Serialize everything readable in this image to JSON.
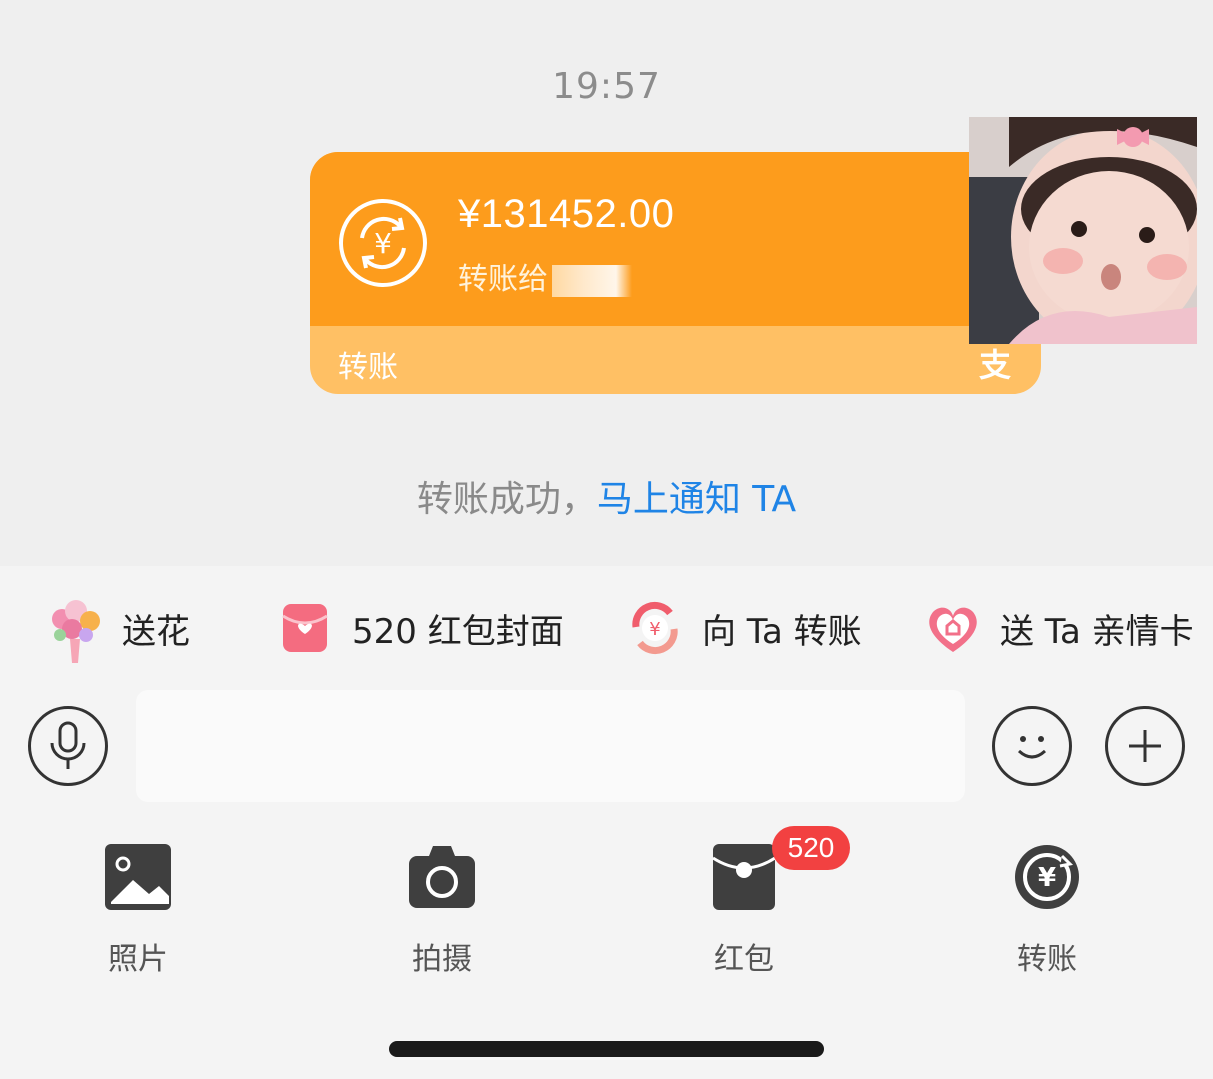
{
  "chat": {
    "timestamp": "19:57",
    "transfer": {
      "amount": "¥131452.00",
      "subtext": "转账给",
      "footer_label": "转账",
      "logo": "支"
    },
    "status": {
      "text": "转账成功，",
      "link": "马上通知 TA"
    }
  },
  "quick_actions": [
    {
      "label": "送花",
      "icon": "flower-bouquet-icon"
    },
    {
      "label": "520 红包封面",
      "icon": "red-envelope-cover-icon"
    },
    {
      "label": "向 Ta 转账",
      "icon": "transfer-circle-icon"
    },
    {
      "label": "送 Ta 亲情卡",
      "icon": "heart-card-icon"
    }
  ],
  "composer": {
    "placeholder": "",
    "voice_icon": "microphone-icon",
    "emoji_icon": "smiley-icon",
    "more_icon": "plus-icon"
  },
  "tools": [
    {
      "label": "照片",
      "icon": "photo-icon"
    },
    {
      "label": "拍摄",
      "icon": "camera-icon"
    },
    {
      "label": "红包",
      "icon": "red-packet-icon",
      "badge": "520"
    },
    {
      "label": "转账",
      "icon": "transfer-yuan-icon"
    }
  ],
  "colors": {
    "transfer_orange": "#fd9c1c",
    "transfer_light": "#ffc064",
    "link_blue": "#1f84e6",
    "badge_red": "#f24141"
  }
}
